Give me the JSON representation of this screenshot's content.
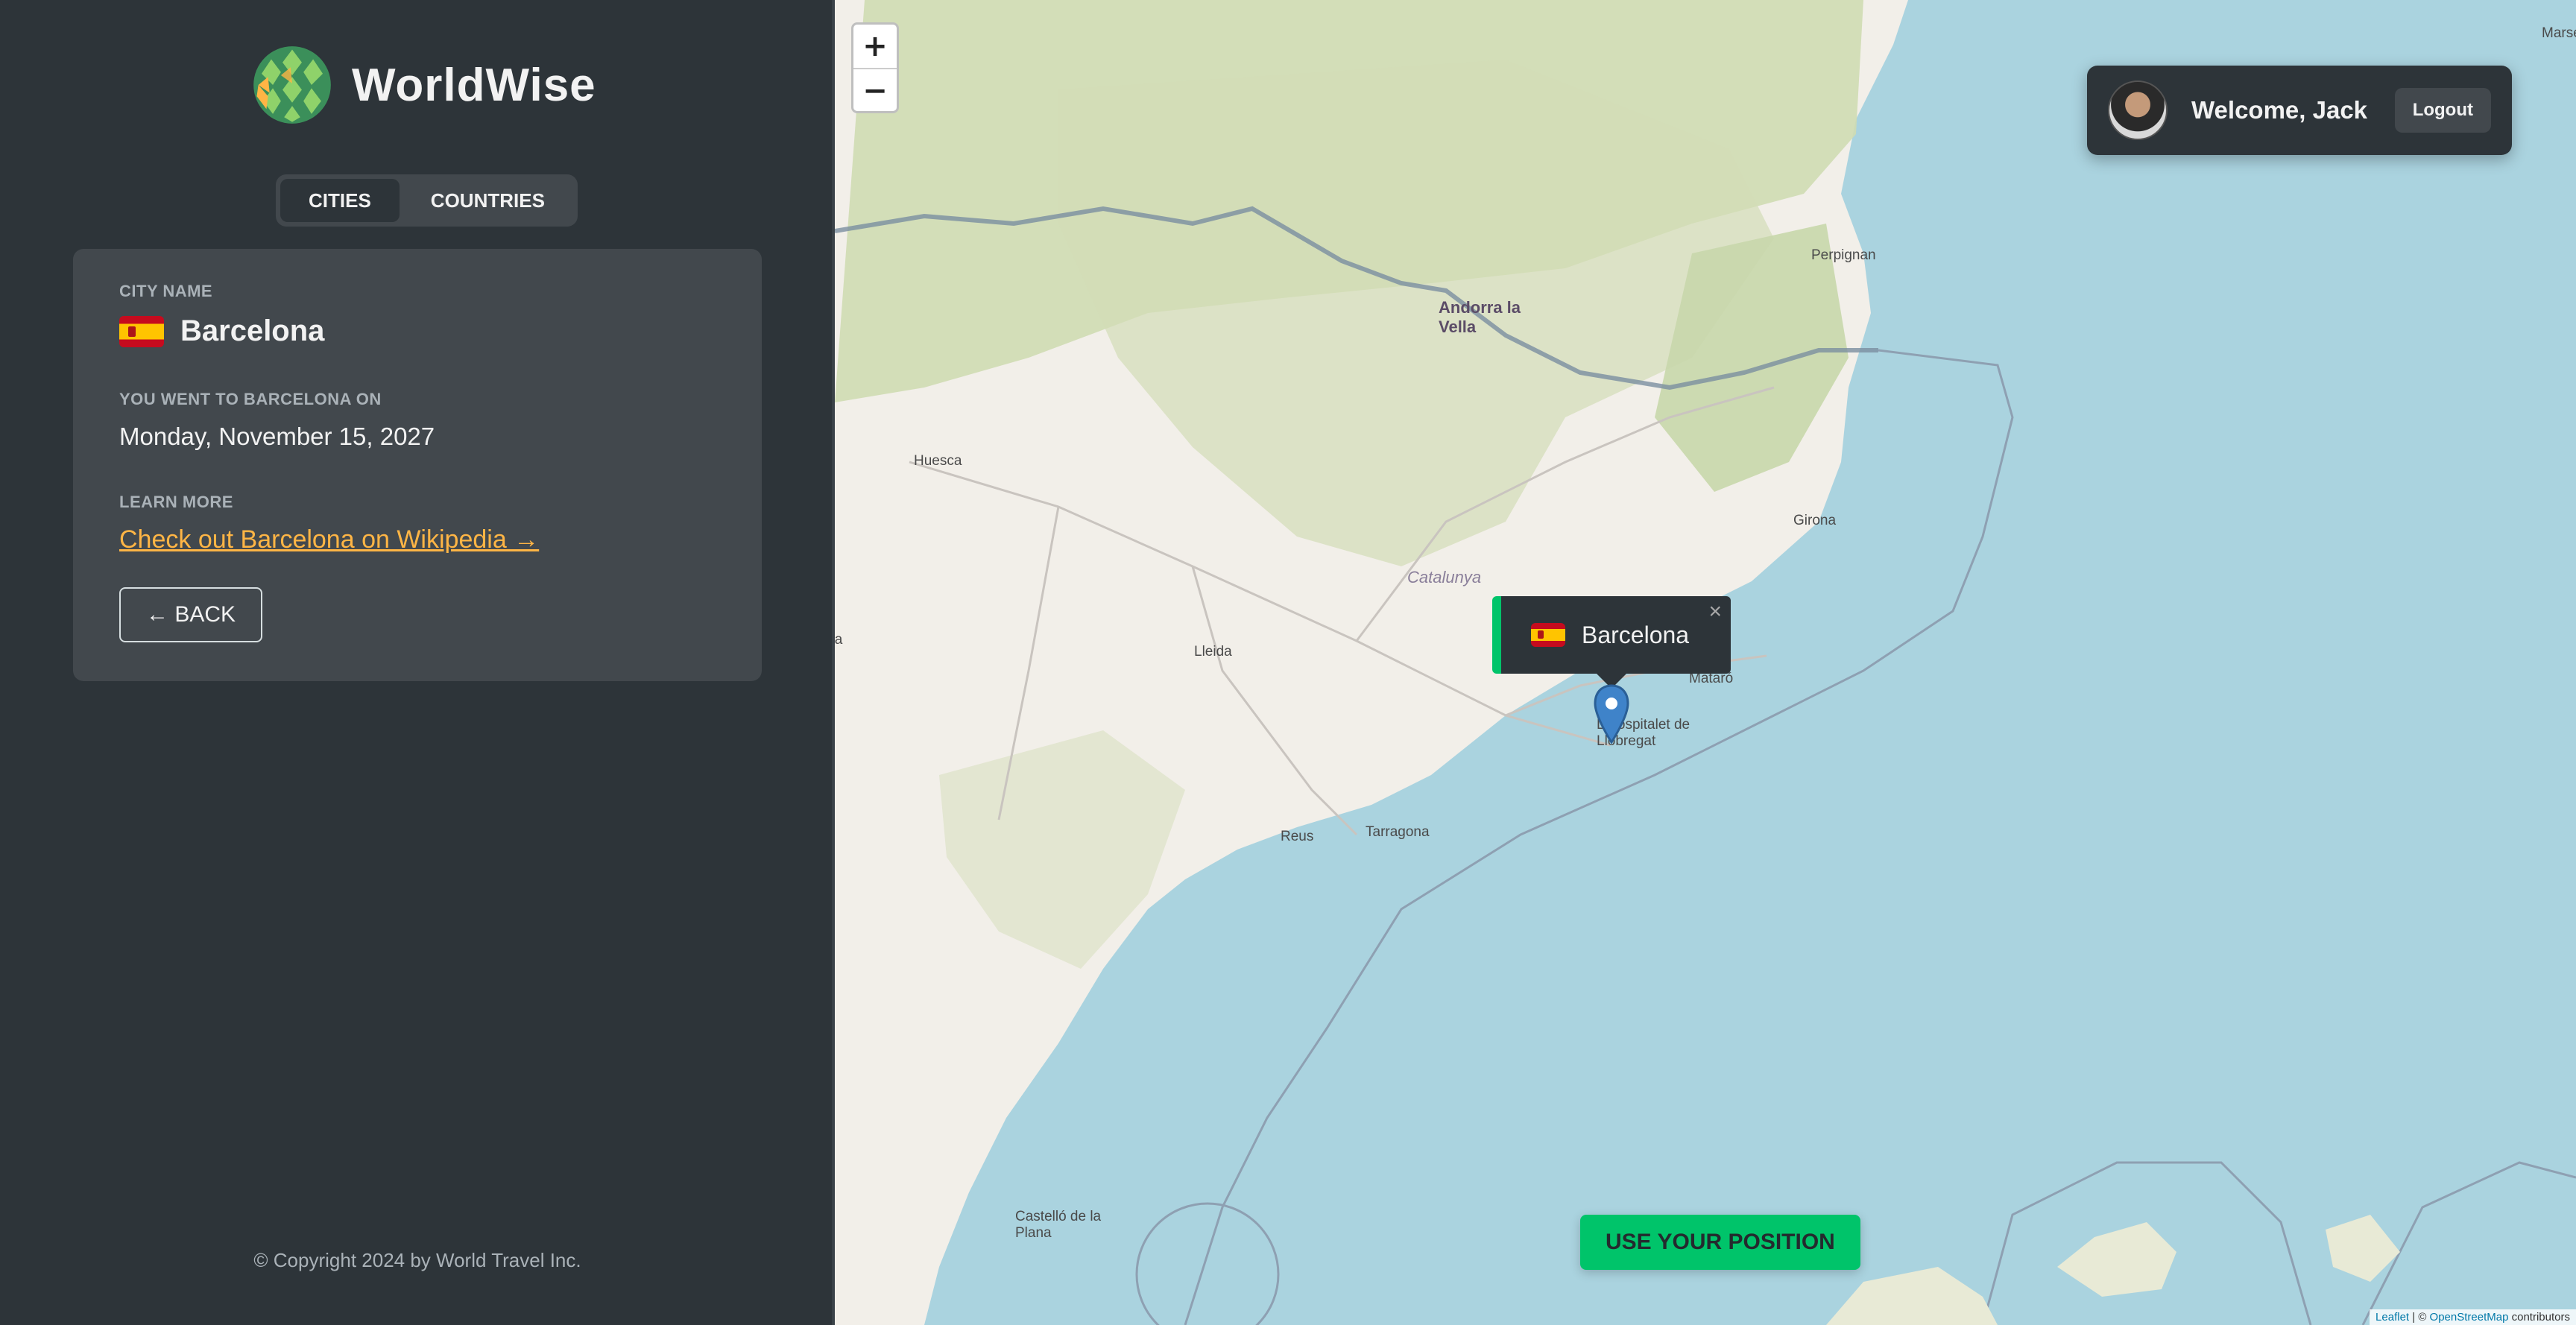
{
  "app": {
    "name": "WorldWise"
  },
  "tabs": [
    {
      "label": "Cities",
      "active": true
    },
    {
      "label": "Countries",
      "active": false
    }
  ],
  "city": {
    "name_label": "City name",
    "name": "Barcelona",
    "flag": "flag-spain-icon",
    "visit_label": "You went to Barcelona on",
    "visit_date": "Monday, November 15, 2027",
    "learn_label": "Learn more",
    "wiki_link": "Check out Barcelona on Wikipedia →",
    "back_button": "← BACK"
  },
  "footer": {
    "copyright": "© Copyright 2024 by World Travel Inc."
  },
  "map": {
    "zoom_in": "+",
    "zoom_out": "−",
    "user": {
      "welcome": "Welcome, Jack",
      "logout": "Logout"
    },
    "popup": {
      "city": "Barcelona",
      "close": "×"
    },
    "use_position": "Use your position",
    "attribution": {
      "leaflet": "Leaflet",
      "sep": " | © ",
      "osm": "OpenStreetMap",
      "rest": " contributors"
    },
    "labels": {
      "marseille": "Marseille",
      "perpignan": "Perpignan",
      "andorra": "Andorra la Vella",
      "huesca": "Huesca",
      "girona": "Girona",
      "catalunya": "Catalunya",
      "lleida": "Lleida",
      "mataro": "Mataró",
      "hospitalet": "L'Hospitalet de Llobregat",
      "reus": "Reus",
      "tarragona": "Tarragona",
      "castello": "Castelló de la Plana",
      "zaragoza": "Zaragoza"
    },
    "colors": {
      "sea": "#aad3df",
      "land": "#f2efe9",
      "forest": "#c8d7ab",
      "accent": "#00c46a",
      "popup_bg": "#2d3439"
    }
  },
  "colors": {
    "sidebar_bg": "#2d3439",
    "card_bg": "#42484d",
    "link": "#ffb545"
  }
}
